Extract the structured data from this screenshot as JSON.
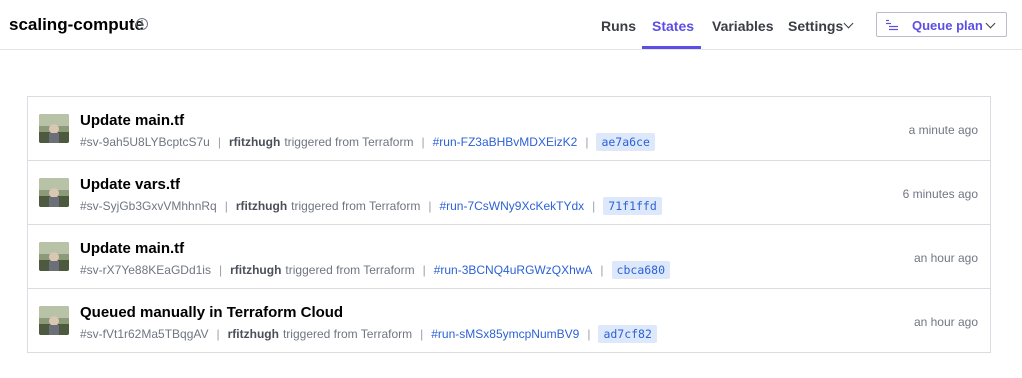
{
  "header": {
    "workspace_title": "scaling-compute",
    "info_icon": "info-icon",
    "tabs": [
      {
        "label": "Runs"
      },
      {
        "label": "States",
        "active": true
      },
      {
        "label": "Variables"
      },
      {
        "label": "Settings"
      }
    ],
    "queue_plan_label": "Queue plan",
    "accent_color": "#5c4ee5"
  },
  "states": [
    {
      "title": "Update main.tf",
      "state_id": "#sv-9ah5U8LYBcptcS7u",
      "user": "rfitzhugh",
      "trigger_text": "triggered from Terraform",
      "run_id": "#run-FZ3aBHBvMDXEizK2",
      "commit": "ae7a6ce",
      "time": "a minute ago"
    },
    {
      "title": "Update vars.tf",
      "state_id": "#sv-SyjGb3GxvVMhhnRq",
      "user": "rfitzhugh",
      "trigger_text": "triggered from Terraform",
      "run_id": "#run-7CsWNy9XcKekTYdx",
      "commit": "71f1ffd",
      "time": "6 minutes ago"
    },
    {
      "title": "Update main.tf",
      "state_id": "#sv-rX7Ye88KEaGDd1is",
      "user": "rfitzhugh",
      "trigger_text": "triggered from Terraform",
      "run_id": "#run-3BCNQ4uRGWzQXhwA",
      "commit": "cbca680",
      "time": "an hour ago"
    },
    {
      "title": "Queued manually in Terraform Cloud",
      "state_id": "#sv-fVt1r62Ma5TBqgAV",
      "user": "rfitzhugh",
      "trigger_text": "triggered from Terraform",
      "run_id": "#run-sMSx85ymcpNumBV9",
      "commit": "ad7cf82",
      "time": "an hour ago"
    }
  ],
  "separator": "|"
}
